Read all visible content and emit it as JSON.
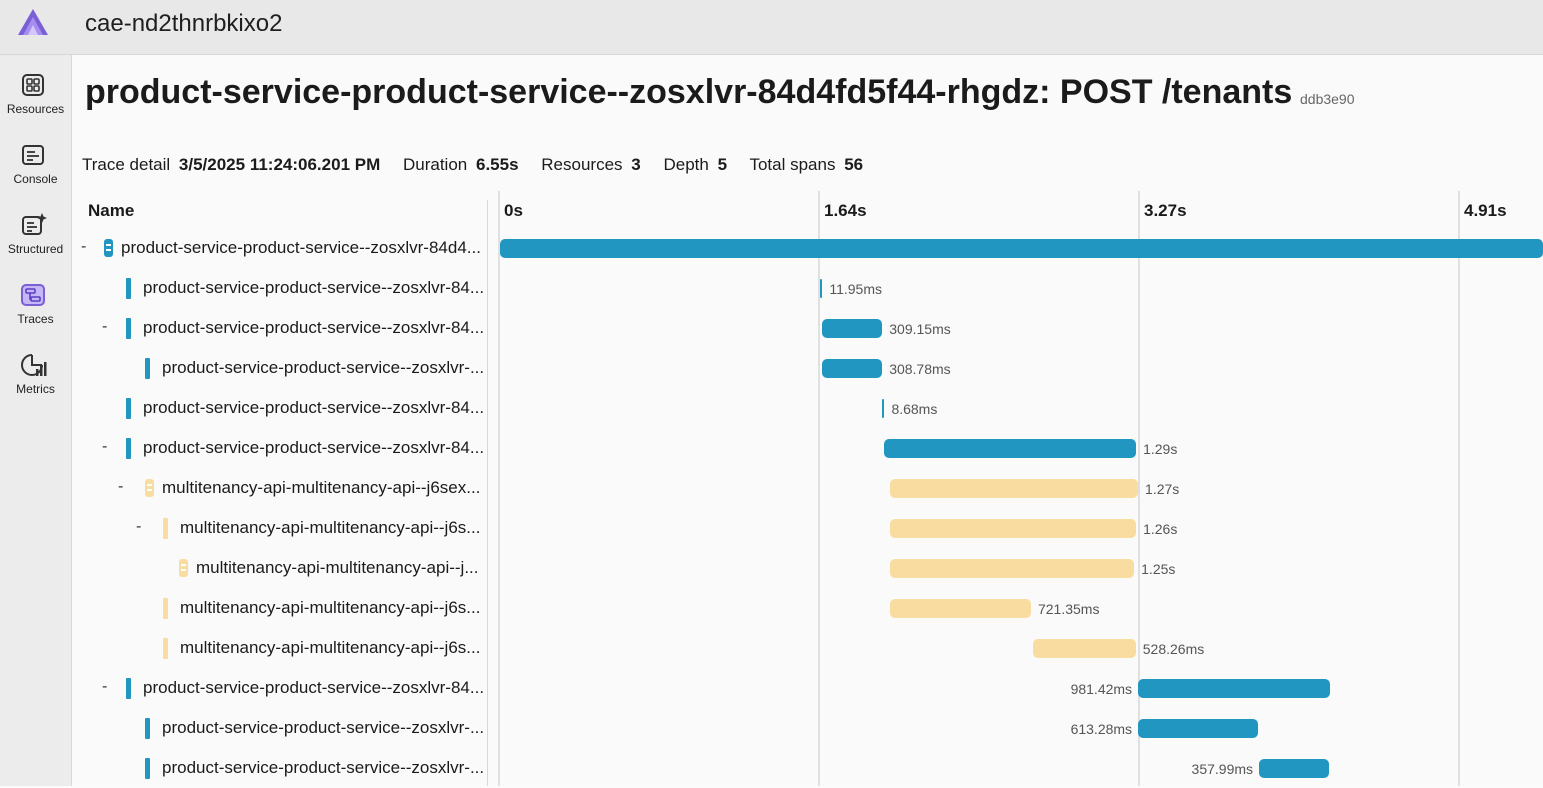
{
  "app": {
    "title": "cae-nd2thnrbkixo2",
    "logo": "aspire-logo-icon"
  },
  "sidebar": {
    "items": [
      {
        "label": "Resources",
        "icon": "grid-icon"
      },
      {
        "label": "Console",
        "icon": "console-icon"
      },
      {
        "label": "Structured",
        "icon": "structured-logs-icon"
      },
      {
        "label": "Traces",
        "icon": "traces-icon",
        "active": true
      },
      {
        "label": "Metrics",
        "icon": "metrics-icon"
      }
    ]
  },
  "header": {
    "title": "product-service-product-service--zosxlvr-84d4fd5f44-rhgdz: POST /tenants",
    "trace_id": "ddb3e90"
  },
  "summary": {
    "trace_detail_label": "Trace detail",
    "trace_detail_value": "3/5/2025 11:24:06.201 PM",
    "duration_label": "Duration",
    "duration_value": "6.55s",
    "resources_label": "Resources",
    "resources_value": "3",
    "depth_label": "Depth",
    "depth_value": "5",
    "total_spans_label": "Total spans",
    "total_spans_value": "56"
  },
  "grid": {
    "name_header": "Name",
    "ticks": [
      "0s",
      "1.64s",
      "3.27s",
      "4.91s"
    ],
    "total_seconds": 6.55,
    "rows": [
      {
        "toggle": "-",
        "name": "product-service-product-service--zosxlvr-84d4...",
        "start": 0,
        "duration_s": 6.55,
        "label": "",
        "color": "#2196c1",
        "kind": "resource",
        "depth": 0
      },
      {
        "toggle": "",
        "name": "product-service-product-service--zosxlvr-84...",
        "start": 1.64,
        "duration_s": 0.01195,
        "label": "11.95ms",
        "color": "#2196c1",
        "kind": "span",
        "depth": 1
      },
      {
        "toggle": "-",
        "name": "product-service-product-service--zosxlvr-84...",
        "start": 1.65,
        "duration_s": 0.30915,
        "label": "309.15ms",
        "color": "#2196c1",
        "kind": "span",
        "depth": 1
      },
      {
        "toggle": "",
        "name": "product-service-product-service--zosxlvr-...",
        "start": 1.65,
        "duration_s": 0.30878,
        "label": "308.78ms",
        "color": "#2196c1",
        "kind": "span",
        "depth": 2
      },
      {
        "toggle": "",
        "name": "product-service-product-service--zosxlvr-84...",
        "start": 1.96,
        "duration_s": 0.00868,
        "label": "8.68ms",
        "color": "#2196c1",
        "kind": "span",
        "depth": 1
      },
      {
        "toggle": "-",
        "name": "product-service-product-service--zosxlvr-84...",
        "start": 1.97,
        "duration_s": 1.29,
        "label": "1.29s",
        "color": "#2196c1",
        "kind": "span",
        "depth": 1
      },
      {
        "toggle": "-",
        "name": "multitenancy-api-multitenancy-api--j6sex...",
        "start": 2.0,
        "duration_s": 1.27,
        "label": "1.27s",
        "color": "#f9dc9f",
        "kind": "resource",
        "depth": 2
      },
      {
        "toggle": "-",
        "name": "multitenancy-api-multitenancy-api--j6s...",
        "start": 2.0,
        "duration_s": 1.26,
        "label": "1.26s",
        "color": "#f9dc9f",
        "kind": "span",
        "depth": 3
      },
      {
        "toggle": "",
        "name": "multitenancy-api-multitenancy-api--j...",
        "start": 2.0,
        "duration_s": 1.25,
        "label": "1.25s",
        "color": "#f9dc9f",
        "kind": "resource",
        "depth": 4
      },
      {
        "toggle": "",
        "name": "multitenancy-api-multitenancy-api--j6s...",
        "start": 2.0,
        "duration_s": 0.72135,
        "label": "721.35ms",
        "color": "#f9dc9f",
        "kind": "span",
        "depth": 3
      },
      {
        "toggle": "",
        "name": "multitenancy-api-multitenancy-api--j6s...",
        "start": 2.73,
        "duration_s": 0.52826,
        "label": "528.26ms",
        "color": "#f9dc9f",
        "kind": "span",
        "depth": 3
      },
      {
        "toggle": "-",
        "name": "product-service-product-service--zosxlvr-84...",
        "start": 3.27,
        "duration_s": 0.98142,
        "label": "981.42ms",
        "color": "#2196c1",
        "kind": "span",
        "depth": 1,
        "label_left": true
      },
      {
        "toggle": "",
        "name": "product-service-product-service--zosxlvr-...",
        "start": 3.27,
        "duration_s": 0.61328,
        "label": "613.28ms",
        "color": "#2196c1",
        "kind": "span",
        "depth": 2,
        "label_left": true
      },
      {
        "toggle": "",
        "name": "product-service-product-service--zosxlvr-...",
        "start": 3.89,
        "duration_s": 0.35799,
        "label": "357.99ms",
        "color": "#2196c1",
        "kind": "span",
        "depth": 2,
        "label_left": true
      }
    ]
  }
}
